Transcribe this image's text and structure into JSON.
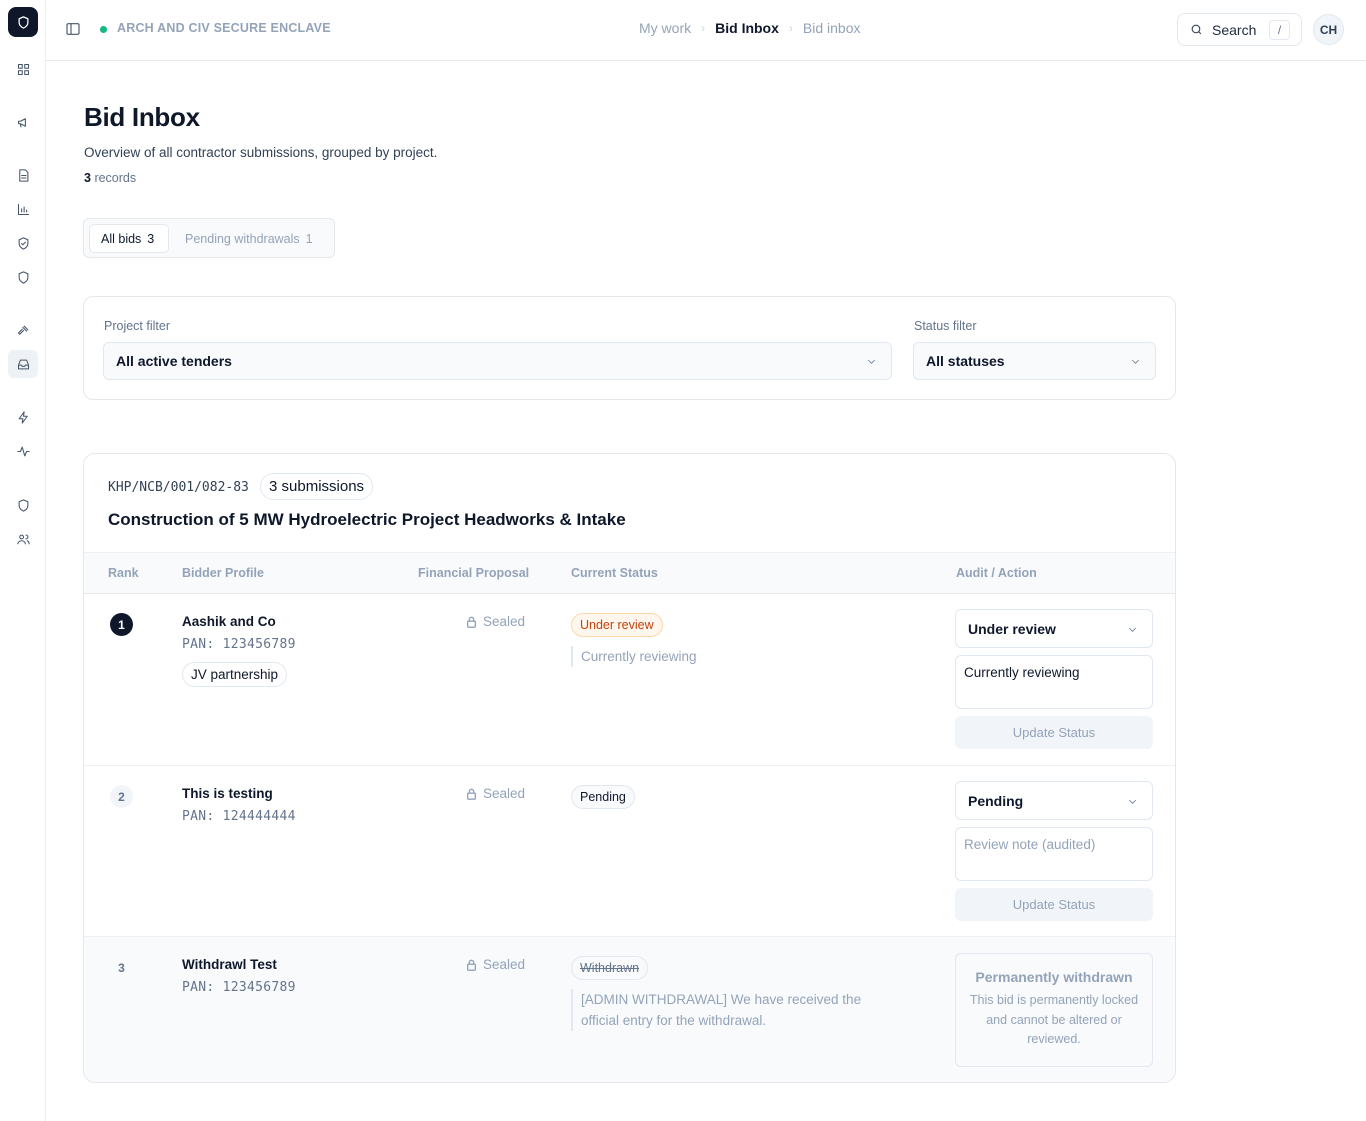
{
  "app": {
    "environment": "ARCH AND CIV SECURE ENCLAVE"
  },
  "breadcrumbs": [
    "My work",
    "Bid Inbox",
    "Bid inbox"
  ],
  "search": {
    "label": "Search",
    "shortcut": "/"
  },
  "user": {
    "initials": "CH"
  },
  "rail_icons": [
    "dashboard-icon",
    "megaphone-icon",
    "document-icon",
    "bar-chart-icon",
    "shield-check-icon",
    "shield-icon",
    "gavel-icon",
    "inbox-icon",
    "lightning-icon",
    "activity-icon",
    "shield-icon",
    "users-icon"
  ],
  "page": {
    "title": "Bid Inbox",
    "subtitle": "Overview of all contractor submissions, grouped by project.",
    "record_count": "3",
    "record_label": "records"
  },
  "tabs": [
    {
      "label": "All bids",
      "count": "3",
      "active": true
    },
    {
      "label": "Pending withdrawals",
      "count": "1",
      "active": false
    }
  ],
  "filters": {
    "project_label": "Project filter",
    "project_value": "All active tenders",
    "status_label": "Status filter",
    "status_value": "All statuses"
  },
  "project": {
    "code": "KHP/NCB/001/082-83",
    "submissions": "3 submissions",
    "title": "Construction of 5 MW Hydroelectric Project Headworks & Intake",
    "columns": [
      "Rank",
      "Bidder Profile",
      "Financial Proposal",
      "Current Status",
      "Audit / Action"
    ],
    "bids": [
      {
        "rank": "1",
        "name": "Aashik and Co",
        "pan": "PAN: 123456789",
        "tag": "JV partnership",
        "proposal": "Sealed",
        "status": "Under review",
        "status_note": "Currently reviewing",
        "action_value": "Under review",
        "action_note": "Currently reviewing",
        "action_button": "Update Status"
      },
      {
        "rank": "2",
        "name": "This is testing",
        "pan": "PAN: 124444444",
        "proposal": "Sealed",
        "status": "Pending",
        "action_value": "Pending",
        "action_placeholder": "Review note (audited)",
        "action_button": "Update Status"
      },
      {
        "rank": "3",
        "name": "Withdrawl Test",
        "pan": "PAN: 123456789",
        "proposal": "Sealed",
        "status": "Withdrawn",
        "status_note": "[ADMIN WITHDRAWAL] We have received the official entry for the withdrawal.",
        "locked_title": "Permanently withdrawn",
        "locked_body": "This bid is permanently locked and cannot be altered or reviewed."
      }
    ]
  }
}
